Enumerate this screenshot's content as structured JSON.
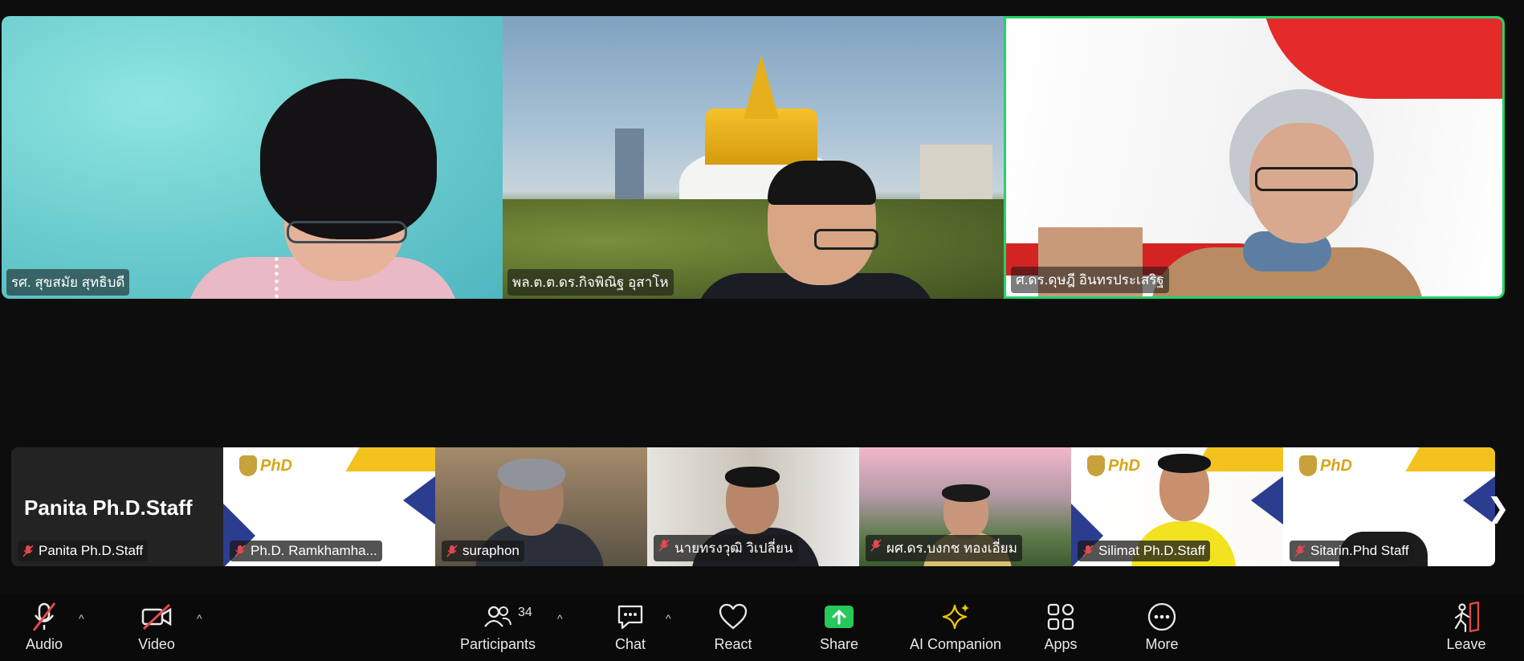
{
  "speakers": [
    {
      "name": "รศ. สุขสมัย สุทธิบดี"
    },
    {
      "name": "พล.ต.ต.ดร.กิจพิณิฐ อุสาโห"
    },
    {
      "name": "ศ.ดร.ดุษฎี อินทรประเสริฐ"
    }
  ],
  "thumbnails": [
    {
      "name": "Panita Ph.D.Staff",
      "display": "Panita Ph.D.Staff",
      "muted": true
    },
    {
      "name": "Ph.D. Ramkhamha...",
      "muted": true
    },
    {
      "name": "suraphon",
      "muted": true
    },
    {
      "name": "นายทรงวุฒิ วิเปลี่ยน",
      "muted": true
    },
    {
      "name": "ผศ.ดร.บงกช ทองเอี่ยม",
      "muted": true
    },
    {
      "name": "Silimat Ph.D.Staff",
      "muted": true
    },
    {
      "name": "Sitarin.Phd Staff",
      "muted": true
    }
  ],
  "phd_logo_text": "PhD",
  "toolbar": {
    "audio": "Audio",
    "video": "Video",
    "participants": "Participants",
    "participants_count": "34",
    "chat": "Chat",
    "react": "React",
    "share": "Share",
    "ai_companion": "AI Companion",
    "apps": "Apps",
    "more": "More",
    "leave": "Leave"
  },
  "colors": {
    "active_speaker_border": "#24d36a",
    "share_green": "#27c85a",
    "mute_red": "#e5484d",
    "ai_yellow": "#f0c400"
  }
}
